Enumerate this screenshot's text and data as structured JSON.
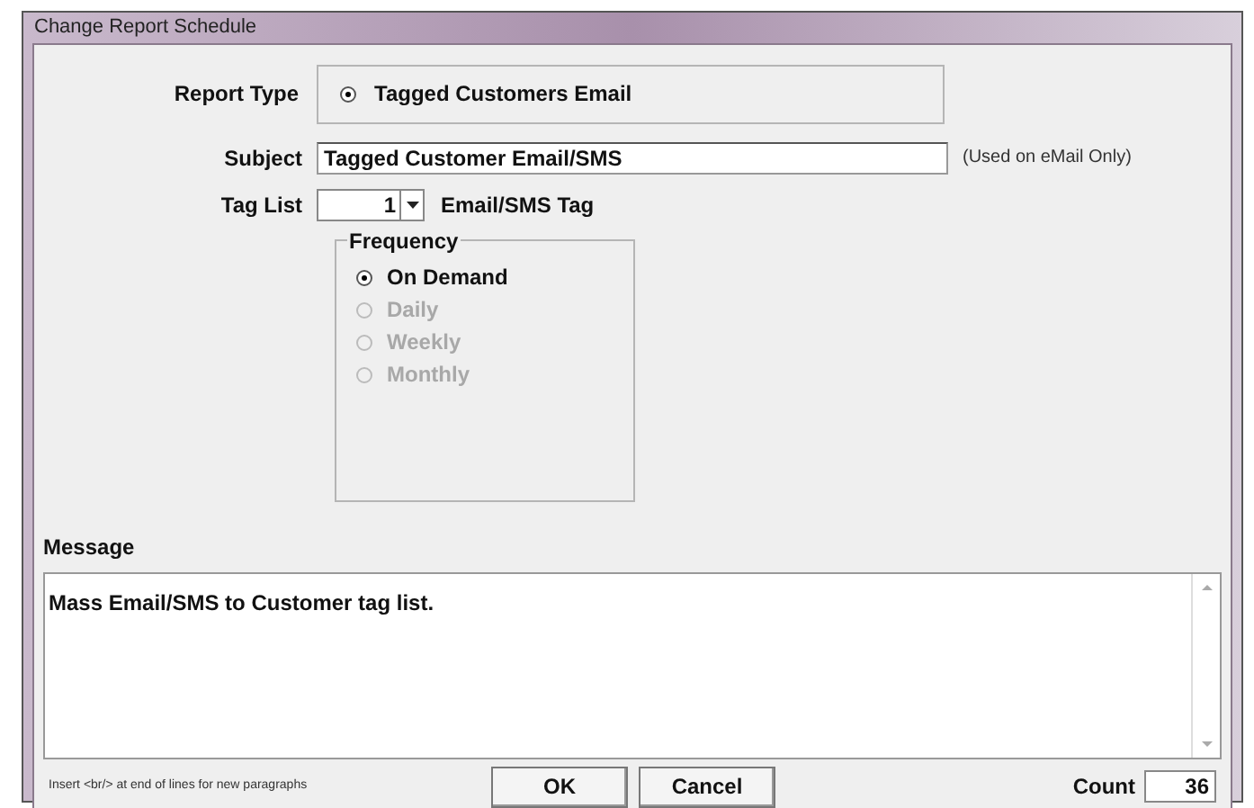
{
  "window": {
    "title": "Change Report Schedule"
  },
  "report_type": {
    "label": "Report Type",
    "options": [
      {
        "label": "Tagged Customers Email",
        "selected": true
      }
    ]
  },
  "subject": {
    "label": "Subject",
    "value": "Tagged Customer Email/SMS",
    "note": "(Used on eMail Only)"
  },
  "tag_list": {
    "label": "Tag List",
    "value": "1",
    "suffix": "Email/SMS Tag"
  },
  "frequency": {
    "title": "Frequency",
    "options": [
      {
        "label": "On Demand",
        "selected": true,
        "disabled": false
      },
      {
        "label": "Daily",
        "selected": false,
        "disabled": true
      },
      {
        "label": "Weekly",
        "selected": false,
        "disabled": true
      },
      {
        "label": "Monthly",
        "selected": false,
        "disabled": true
      }
    ]
  },
  "message": {
    "label": "Message",
    "value": "Mass Email/SMS to Customer tag list."
  },
  "hint": "Insert <br/> at end of lines for new paragraphs",
  "buttons": [
    "OK",
    "Cancel"
  ],
  "count": {
    "label": "Count",
    "value": "36"
  }
}
